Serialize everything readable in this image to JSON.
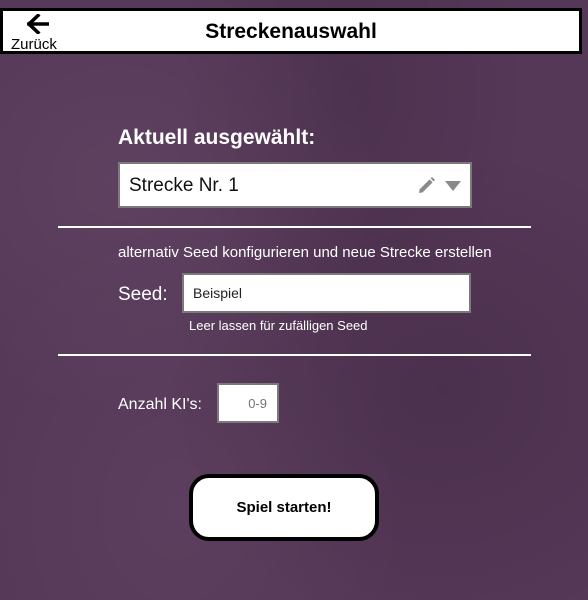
{
  "header": {
    "back_label": "Zurück",
    "title": "Streckenauswahl"
  },
  "selection": {
    "heading": "Aktuell ausgewählt:",
    "current_track": "Strecke Nr. 1"
  },
  "seed": {
    "hint": "alternativ Seed konfigurieren und neue Strecke erstellen",
    "label": "Seed:",
    "value": "Beispiel",
    "sublabel": "Leer lassen für zufälligen Seed"
  },
  "ai": {
    "label": "Anzahl KI's:",
    "placeholder": "0-9"
  },
  "actions": {
    "start_label": "Spiel starten!"
  },
  "icons": {
    "back": "arrow-left-icon",
    "edit": "pencil-icon",
    "dropdown": "chevron-down-icon"
  },
  "colors": {
    "background": "#553757",
    "panel": "#ffffff",
    "border": "#000000"
  }
}
